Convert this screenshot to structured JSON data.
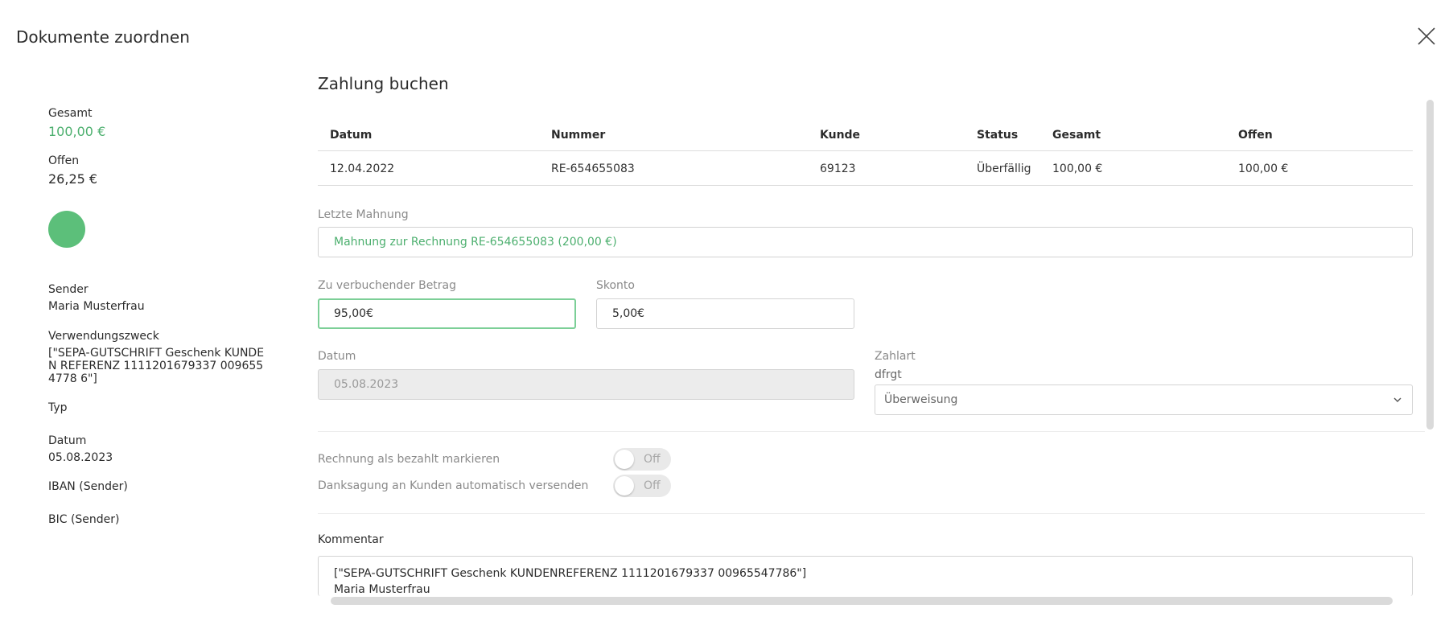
{
  "modal": {
    "title": "Dokumente zuordnen",
    "close_icon": "close-icon"
  },
  "sidebar": {
    "gesamt_label": "Gesamt",
    "gesamt_value": "100,00 €",
    "offen_label": "Offen",
    "offen_value": "26,25 €",
    "status_color": "#5cbf7a",
    "sender_label": "Sender",
    "sender_value": "Maria Musterfrau",
    "purpose_label": "Verwendungszweck",
    "purpose_value": "[\"SEPA-GUTSCHRIFT Geschenk KUNDEN REFERENZ 1111201679337 0096554778 6\"]",
    "type_label": "Typ",
    "date_label": "Datum",
    "date_value": "05.08.2023",
    "iban_label": "IBAN (Sender)",
    "bic_label": "BIC (Sender)"
  },
  "main": {
    "title": "Zahlung buchen",
    "table": {
      "headers": [
        "Datum",
        "Nummer",
        "Kunde",
        "Status",
        "Gesamt",
        "Offen"
      ],
      "rows": [
        [
          "12.04.2022",
          "RE-654655083",
          "69123",
          "Überfällig",
          "100,00 €",
          "100,00 €"
        ]
      ]
    },
    "last_reminder_label": "Letzte Mahnung",
    "last_reminder_value": "Mahnung zur Rechnung RE-654655083 (200,00 €)",
    "amount_label": "Zu verbuchender Betrag",
    "amount_value": "95,00€",
    "discount_label": "Skonto",
    "discount_value": "5,00€",
    "date_label": "Datum",
    "date_value": "05.08.2023",
    "payment_method_label": "Zahlart",
    "payment_method_sublabel": "dfrgt",
    "payment_method_value": "Überweisung",
    "toggles": [
      {
        "label": "Rechnung als bezahlt markieren",
        "state": "Off"
      },
      {
        "label": "Danksagung an Kunden automatisch versenden",
        "state": "Off"
      }
    ],
    "comment_label": "Kommentar",
    "comment_line1": "[\"SEPA-GUTSCHRIFT Geschenk KUNDENREFERENZ 1111201679337 00965547786\"]",
    "comment_line2": "Maria Musterfrau"
  },
  "colors": {
    "accent_green": "#4caf6e",
    "focus_border": "#7ccf97"
  }
}
